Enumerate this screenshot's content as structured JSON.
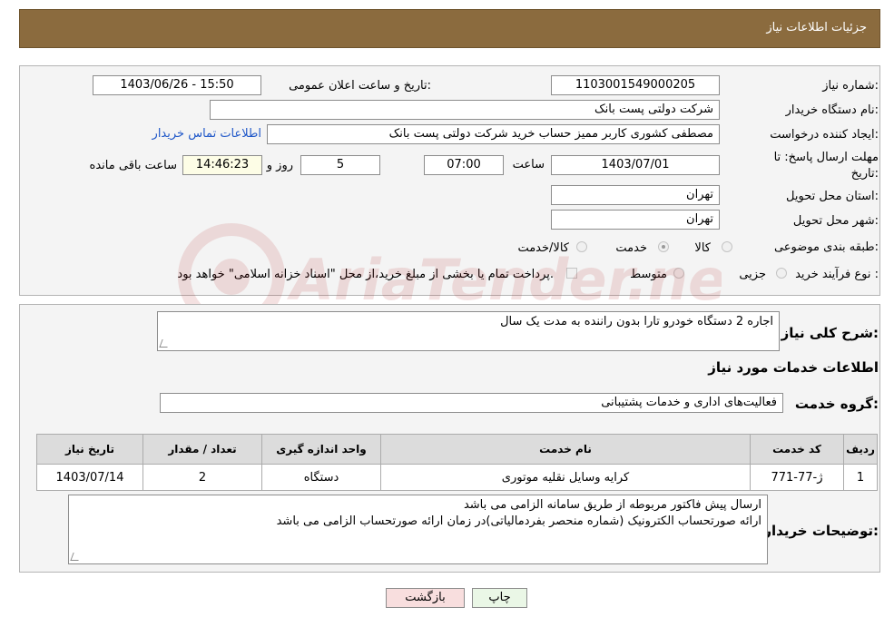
{
  "header": {
    "title": "جزئیات اطلاعات نیاز"
  },
  "info": {
    "need_number_label": "شماره نیاز:",
    "need_number_value": "1103001549000205",
    "announce_label": "تاریخ و ساعت اعلان عمومی:",
    "announce_value": "1403/06/26 - 15:50",
    "buyer_org_label": "نام دستگاه خریدار:",
    "buyer_org_value": "شرکت دولتی پست بانک",
    "creator_label": "ایجاد کننده درخواست:",
    "creator_value": "مصطفی کشوری کاربر ممیز حساب خرید شرکت دولتی پست بانک",
    "contact_link": "اطلاعات تماس خریدار",
    "deadline_label_1": "مهلت ارسال پاسخ: تا",
    "deadline_label_2": "تاریخ:",
    "deadline_date": "1403/07/01",
    "time_label": "ساعت",
    "deadline_time": "07:00",
    "days_value": "5",
    "days_label": "روز و",
    "remaining_value": "14:46:23",
    "remaining_label": "ساعت باقی مانده",
    "province_label": "استان محل تحویل:",
    "province_value": "تهران",
    "city_label": "شهر محل تحویل:",
    "city_value": "تهران",
    "category_label": "طبقه بندی موضوعی:",
    "category_options": [
      "کالا",
      "خدمت",
      "کالا/خدمت"
    ],
    "category_selected": "خدمت",
    "process_label": "نوع فرآیند خرید :",
    "process_options": [
      "جزیی",
      "متوسط"
    ],
    "payment_note": "پرداخت تمام یا بخشی از مبلغ خرید،از محل \"اسناد خزانه اسلامی\" خواهد بود."
  },
  "details": {
    "summary_label": "شرح کلی نیاز:",
    "summary_value": "اجاره 2 دستگاه خودرو تارا بدون راننده به مدت یک سال",
    "services_title": "اطلاعات خدمات مورد نیاز",
    "service_group_label": "گروه خدمت:",
    "service_group_value": "فعالیت‌های اداری و خدمات پشتیبانی",
    "table": {
      "headers": [
        "ردیف",
        "کد خدمت",
        "نام خدمت",
        "واحد اندازه گیری",
        "تعداد / مقدار",
        "تاریخ نیاز"
      ],
      "rows": [
        [
          "1",
          "ژ-77-771",
          "کرایه وسایل نقلیه موتوری",
          "دستگاه",
          "2",
          "1403/07/14"
        ]
      ]
    },
    "buyer_notes_label": "توضیحات خریدار:",
    "buyer_notes_line1": "ارسال پیش فاکتور مربوطه از طریق سامانه الزامی می باشد",
    "buyer_notes_line2": "ارائه صورتحساب الکترونیک (شماره منحصر بفردمالیاتی)در زمان ارائه صورتحساب الزامی می باشد"
  },
  "buttons": {
    "print": "چاپ",
    "back": "بازگشت"
  },
  "watermark": {
    "text": "AriaTender.neT"
  },
  "colors": {
    "header_bg": "#8b6b3e",
    "link": "#1f57c8",
    "back_button_bg": "#f8dede",
    "print_button_bg": "#eaf7e6"
  }
}
